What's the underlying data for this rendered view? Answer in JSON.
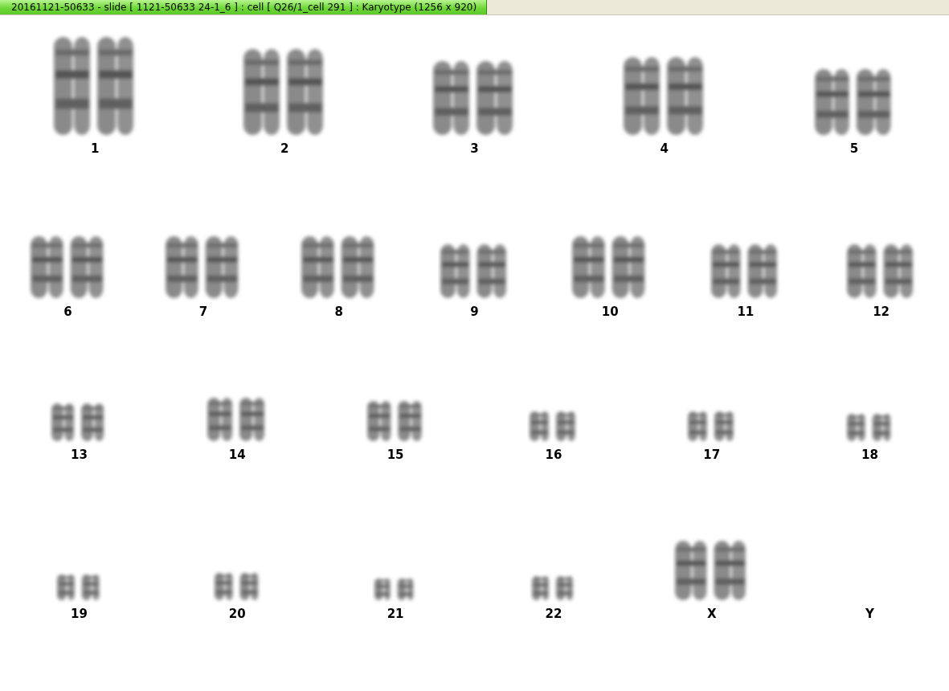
{
  "window": {
    "title": "20161121-50633 - slide [ 1121-50633 24-1_6 ] : cell [ Q26/1_cell 291 ] : Karyotype  (1256 x 920)"
  },
  "karyotype": {
    "rows": [
      {
        "items": [
          {
            "label": "1",
            "kind": "pair"
          },
          {
            "label": "2",
            "kind": "pair"
          },
          {
            "label": "3",
            "kind": "pair"
          },
          {
            "label": "4",
            "kind": "pair"
          },
          {
            "label": "5",
            "kind": "pair"
          }
        ]
      },
      {
        "items": [
          {
            "label": "6",
            "kind": "pair"
          },
          {
            "label": "7",
            "kind": "pair"
          },
          {
            "label": "8",
            "kind": "pair"
          },
          {
            "label": "9",
            "kind": "pair"
          },
          {
            "label": "10",
            "kind": "pair"
          },
          {
            "label": "11",
            "kind": "pair"
          },
          {
            "label": "12",
            "kind": "pair"
          }
        ]
      },
      {
        "items": [
          {
            "label": "13",
            "kind": "pair"
          },
          {
            "label": "14",
            "kind": "pair"
          },
          {
            "label": "15",
            "kind": "pair"
          },
          {
            "label": "16",
            "kind": "pair"
          },
          {
            "label": "17",
            "kind": "pair"
          },
          {
            "label": "18",
            "kind": "pair"
          }
        ]
      },
      {
        "items": [
          {
            "label": "19",
            "kind": "pair"
          },
          {
            "label": "20",
            "kind": "pair"
          },
          {
            "label": "21",
            "kind": "pair"
          },
          {
            "label": "22",
            "kind": "pair"
          },
          {
            "label": "X",
            "kind": "pair"
          },
          {
            "label": "Y",
            "kind": "empty"
          }
        ]
      }
    ]
  }
}
